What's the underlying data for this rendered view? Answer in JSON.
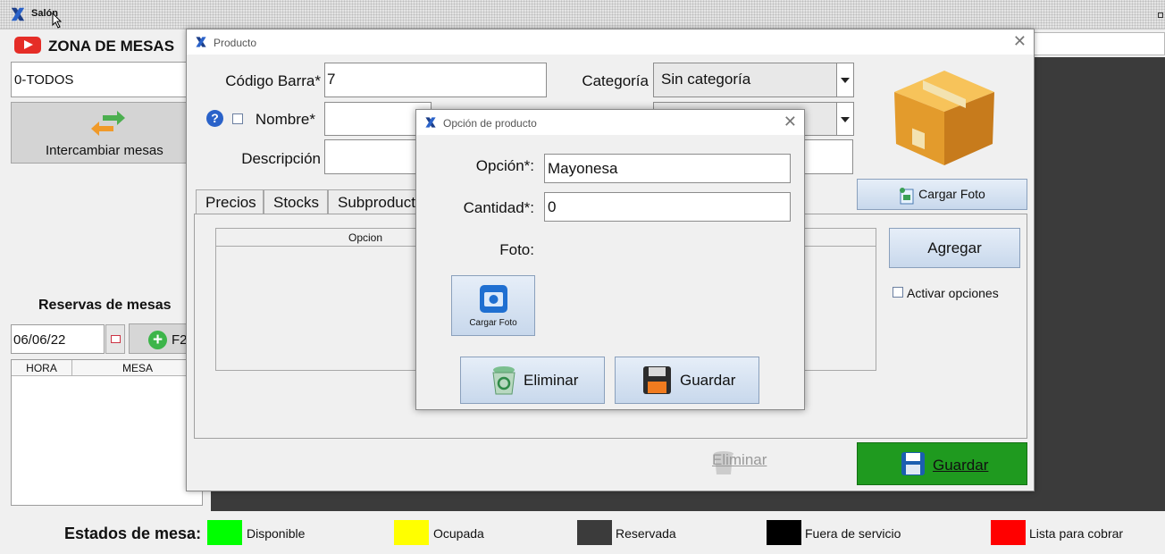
{
  "main_window": {
    "title": "Salón"
  },
  "left_panel": {
    "zone_title": "ZONA DE MESAS",
    "zone_selected": "0-TODOS",
    "swap_label": "Intercambiar mesas",
    "reservas_title": "Reservas de mesas",
    "date_value": "06/06/22",
    "f2_label": "F2",
    "table_headers": [
      "HORA",
      "MESA"
    ]
  },
  "legend": {
    "title": "Estados de mesa:",
    "items": [
      {
        "label": "Disponible",
        "color": "#00ff00"
      },
      {
        "label": "Ocupada",
        "color": "#ffff00"
      },
      {
        "label": "Reservada",
        "color": "#3b3b3b"
      },
      {
        "label": "Fuera de servicio",
        "color": "#000000"
      },
      {
        "label": "Lista para cobrar",
        "color": "#ff0000"
      }
    ]
  },
  "product_dialog": {
    "title": "Producto",
    "codigo_label": "Código Barra*",
    "codigo_value": "7",
    "nombre_label": "Nombre*",
    "descripcion_label": "Descripción",
    "categoria_label": "Categoría",
    "categoria_value": "Sin categoría",
    "cargar_foto": "Cargar Foto",
    "tabs": [
      "Precios",
      "Stocks",
      "Subproduct"
    ],
    "table_header": "Opcion",
    "agregar": "Agregar",
    "activar_opciones": "Activar opciones",
    "eliminar": "Eliminar",
    "guardar": "Guardar"
  },
  "option_dialog": {
    "title": "Opción de producto",
    "opcion_label": "Opción*:",
    "opcion_value": "Mayonesa",
    "cantidad_label": "Cantidad*:",
    "cantidad_value": "0",
    "foto_label": "Foto:",
    "cargar_foto": "Cargar Foto",
    "eliminar": "Eliminar",
    "guardar": "Guardar"
  }
}
